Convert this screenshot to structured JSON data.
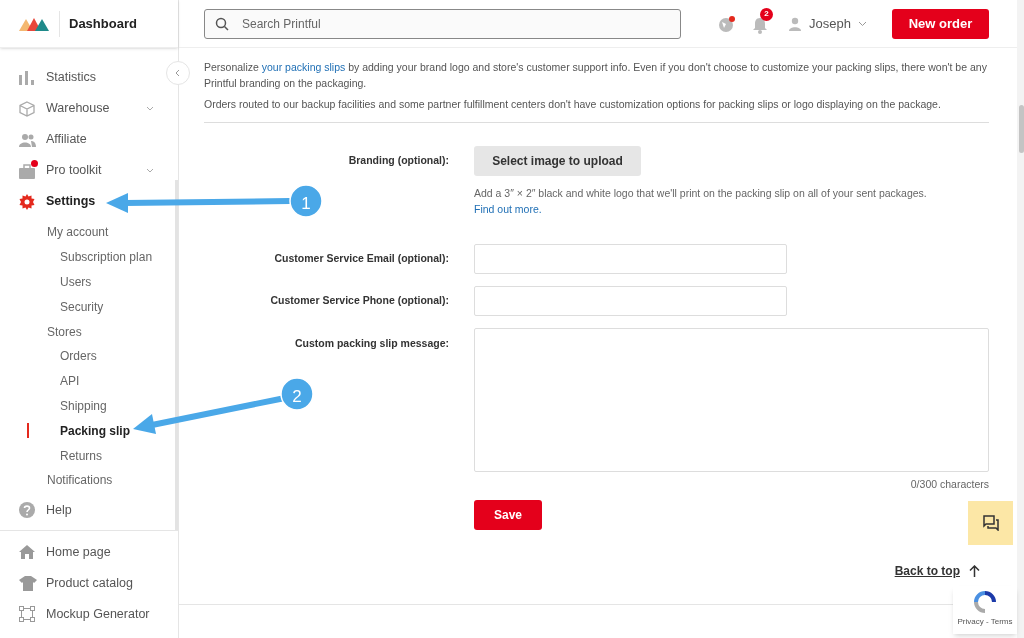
{
  "header": {
    "title": "Dashboard",
    "search": {
      "placeholder": "Search Printful"
    },
    "notification_count": "2",
    "user": "Joseph",
    "new_order_button": "New order"
  },
  "sidebar": {
    "items": [
      {
        "label": "Statistics",
        "kind": "link",
        "selected": false,
        "dot": false
      },
      {
        "label": "Warehouse",
        "kind": "dropdown",
        "selected": false,
        "dot": false
      },
      {
        "label": "Affiliate",
        "kind": "link",
        "selected": false,
        "dot": false
      },
      {
        "label": "Pro toolkit",
        "kind": "dropdown",
        "selected": false,
        "dot": true
      },
      {
        "label": "Settings",
        "kind": "link",
        "selected": true,
        "dot": false,
        "children": [
          {
            "label": "My account",
            "selected": false,
            "children": [
              {
                "label": "Subscription plan",
                "selected": false
              },
              {
                "label": "Users",
                "selected": false
              },
              {
                "label": "Security",
                "selected": false
              }
            ]
          },
          {
            "label": "Stores",
            "selected": false,
            "children": [
              {
                "label": "Orders",
                "selected": false
              },
              {
                "label": "API",
                "selected": false
              },
              {
                "label": "Shipping",
                "selected": false
              },
              {
                "label": "Packing slip",
                "selected": true
              },
              {
                "label": "Returns",
                "selected": false
              }
            ]
          },
          {
            "label": "Notifications",
            "selected": false
          }
        ]
      },
      {
        "label": "Help",
        "kind": "link",
        "selected": false,
        "dot": false
      }
    ],
    "bottom_items": [
      {
        "label": "Home page"
      },
      {
        "label": "Product catalog"
      },
      {
        "label": "Mockup Generator"
      }
    ]
  },
  "content": {
    "intro": {
      "before": "Personalize ",
      "link": "your packing slips",
      "after": " by adding your brand logo and store's customer support info. Even if you don't choose to customize your packing slips, there won't be any Printful branding on the packaging."
    },
    "notice": "Orders routed to our backup facilities and some partner fulfillment centers don't have customization options for packing slips or logo displaying on the package.",
    "branding": {
      "label": "Branding (optional):",
      "button": "Select image to upload",
      "hint": "Add a 3″ × 2″ black and white logo that we'll print on the packing slip on all of your sent packages.",
      "hint_link": "Find out more."
    },
    "fields": [
      {
        "label": "Customer Service Email (optional):",
        "kind": "input"
      },
      {
        "label": "Customer Service Phone (optional):",
        "kind": "input"
      },
      {
        "label": "Custom packing slip message:",
        "kind": "textarea"
      }
    ],
    "counter": "0/300 characters",
    "save_button": "Save",
    "back_to_top": "Back to top",
    "recaptcha": "Privacy - Terms"
  },
  "annotations": [
    {
      "number": "1"
    },
    {
      "number": "2"
    }
  ]
}
